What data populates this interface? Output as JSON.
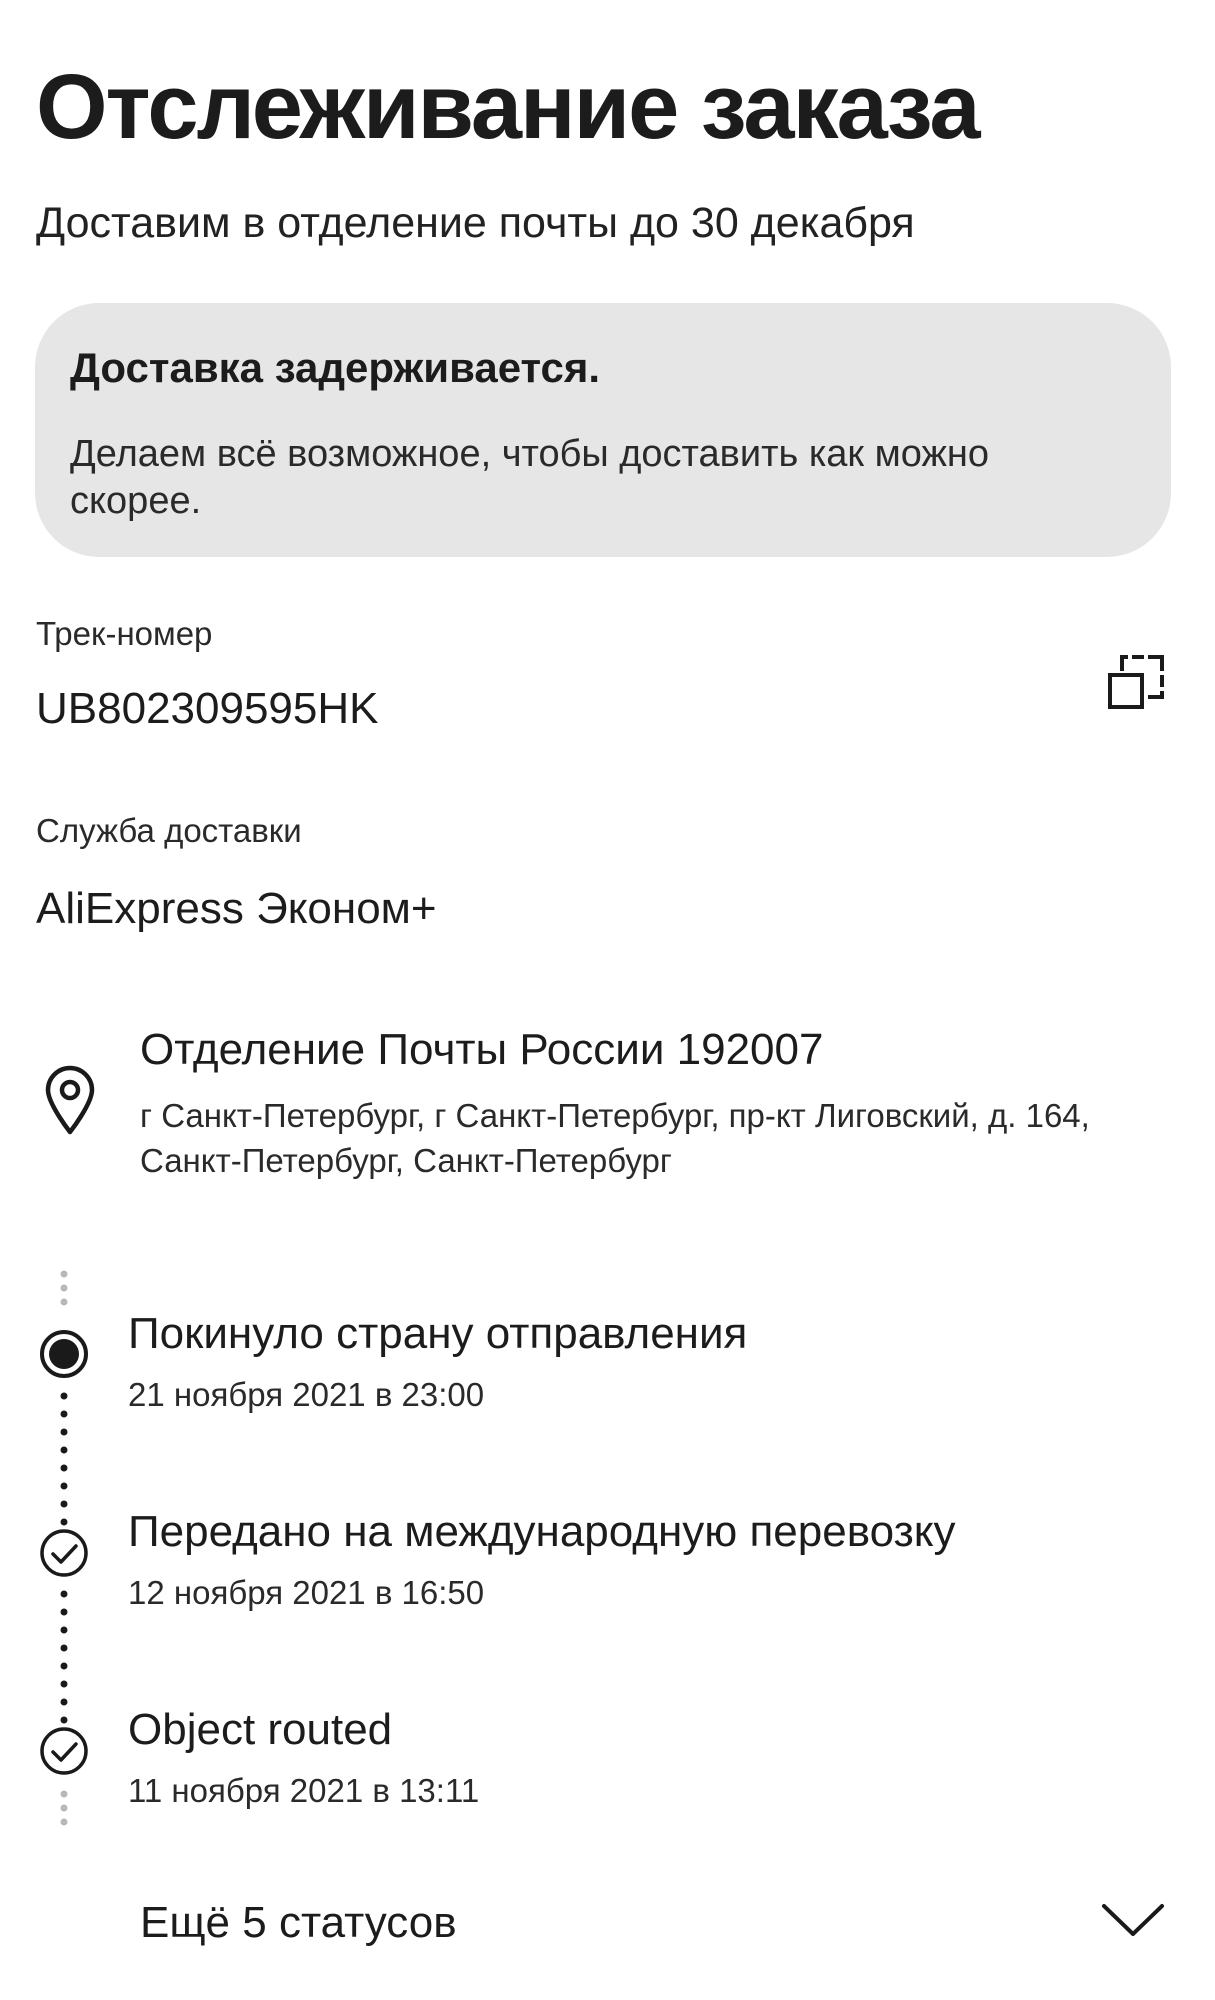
{
  "header": {
    "title": "Отслеживание заказа",
    "subtitle": "Доставим в отделение почты до 30 декабря"
  },
  "notice": {
    "title": "Доставка задерживается.",
    "text": "Делаем всё возможное, чтобы доставить как можно скорее."
  },
  "tracking": {
    "label": "Трек-номер",
    "number": "UB802309595HK",
    "copy_icon": "copy-icon"
  },
  "service": {
    "label": "Служба доставки",
    "name": "AliExpress Эконом+"
  },
  "pickup": {
    "icon": "location-pin-icon",
    "name": "Отделение Почты России 192007",
    "address": "г Санкт-Петербург, г Санкт-Петербург, пр-кт Лиговский, д. 164, Санкт-Петербург, Санкт-Петербург"
  },
  "statuses": [
    {
      "title": "Покинуло страну отправления",
      "date": "21 ноября 2021 в 23:00",
      "icon": "current-status-dot-icon"
    },
    {
      "title": "Передано на международную перевозку",
      "date": "12 ноября 2021 в 16:50",
      "icon": "check-circle-icon"
    },
    {
      "title": "Object routed",
      "date": "11 ноября 2021 в 13:11",
      "icon": "check-circle-icon"
    }
  ],
  "more": {
    "label": "Ещё 5 статусов",
    "icon": "chevron-down-icon"
  }
}
